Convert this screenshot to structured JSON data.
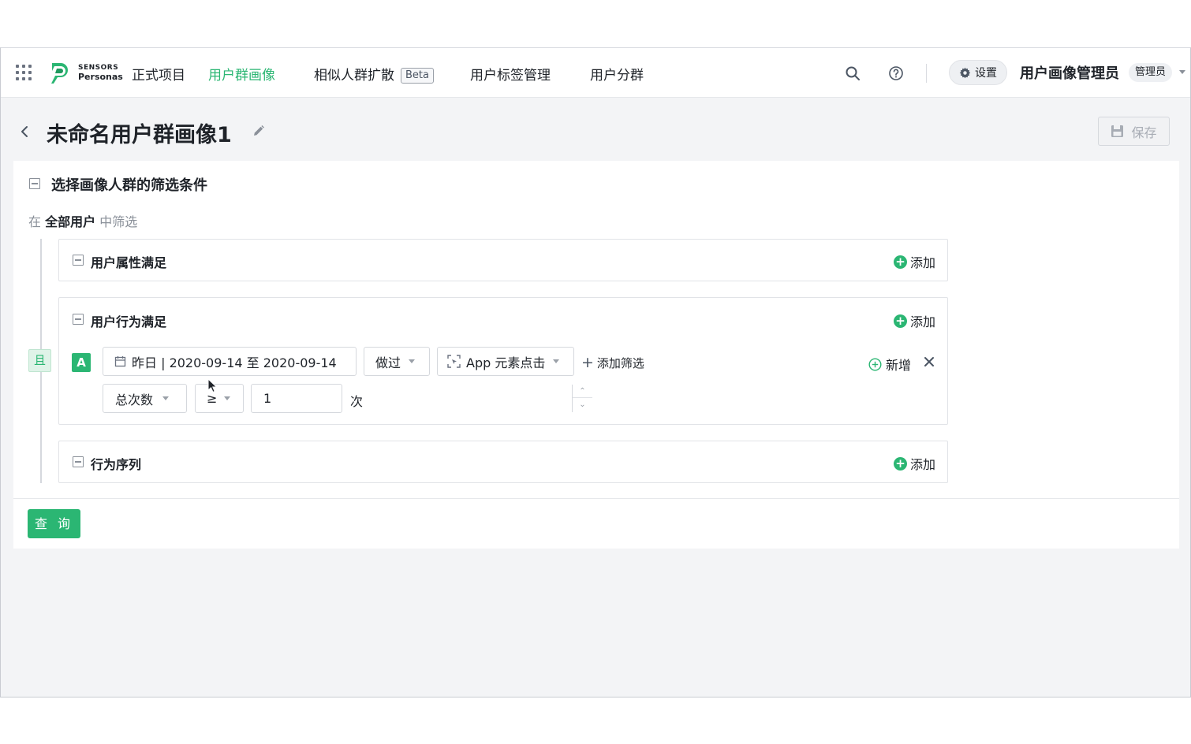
{
  "nav": {
    "logo_line1": "SENSORS",
    "logo_line2": "Personas",
    "items": [
      {
        "label": "正式项目"
      },
      {
        "label": "用户群画像"
      },
      {
        "label": "相似人群扩散"
      },
      {
        "label": "用户标签管理"
      },
      {
        "label": "用户分群"
      }
    ],
    "beta_label": "Beta",
    "settings_label": "设置",
    "user_name": "用户画像管理员",
    "role_label": "管理员",
    "active_color": "#2bb673"
  },
  "header": {
    "title": "未命名用户群画像1",
    "save_label": "保存"
  },
  "filter": {
    "section_title": "选择画像人群的筛选条件",
    "scope_prefix": "在",
    "scope_target": "全部用户",
    "scope_suffix": "中筛选",
    "and_label": "且",
    "add_label": "添加",
    "groups": [
      {
        "label": "用户属性满足"
      },
      {
        "label": "用户行为满足"
      },
      {
        "label": "行为序列"
      }
    ],
    "behavior_rule": {
      "badge": "A",
      "date_range": "昨日 | 2020-09-14 至 2020-09-14",
      "action": "做过",
      "event": "App 元素点击",
      "add_filter_label": "添加筛选",
      "new_label": "新增",
      "metric": "总次数",
      "operator": "≥",
      "value": "1",
      "unit": "次"
    },
    "query_label": "查 询"
  }
}
